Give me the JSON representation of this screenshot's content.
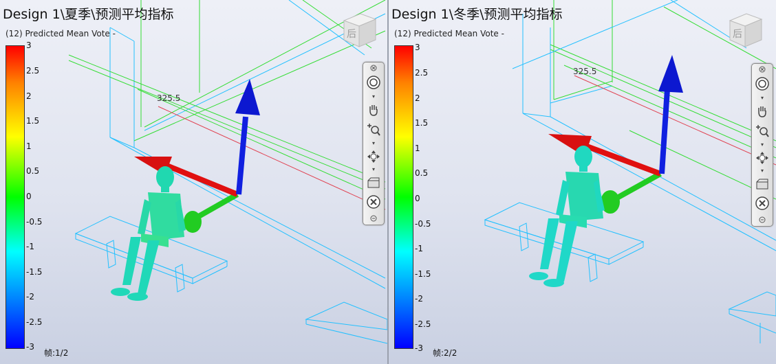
{
  "views": [
    {
      "title": "Design 1\\夏季\\预测平均指标",
      "legend_title": "(12) Predicted Mean Vote -",
      "dimension_label": "325.5",
      "frame_label": "帧:1/2"
    },
    {
      "title": "Design 1\\冬季\\预测平均指标",
      "legend_title": "(12) Predicted Mean Vote -",
      "dimension_label": "325.5",
      "frame_label": "帧:2/2"
    }
  ],
  "legend_ticks": [
    "3",
    "2.5",
    "2",
    "1.5",
    "1",
    "0.5",
    "0",
    "-0.5",
    "-1",
    "-1.5",
    "-2",
    "-2.5",
    "-3"
  ],
  "legend_colors": {
    "top": "#ff0000",
    "middle": "#00ff00",
    "bottom": "#0000ff"
  },
  "view_cube_label": "后",
  "toolbar_icons": [
    "close-icon",
    "orbit-icon",
    "dropdown-icon",
    "pan-hand-icon",
    "zoom-icon",
    "dropdown-icon",
    "walk-icon",
    "dropdown-icon",
    "section-icon",
    "fit-view-icon",
    "close-small-icon"
  ]
}
